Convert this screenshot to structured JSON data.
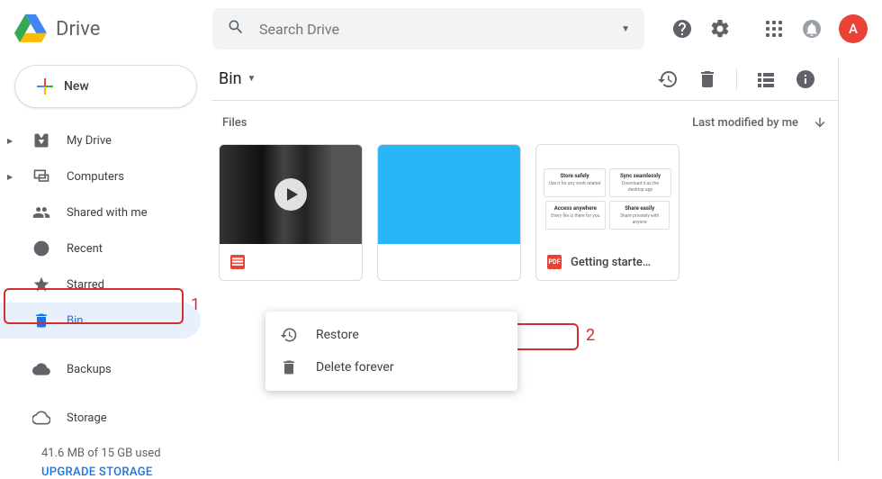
{
  "app_name": "Drive",
  "search_placeholder": "Search Drive",
  "avatar_letter": "A",
  "new_button": "New",
  "sidebar": {
    "items": [
      {
        "label": "My Drive",
        "icon": "drive"
      },
      {
        "label": "Computers",
        "icon": "computers"
      },
      {
        "label": "Shared with me",
        "icon": "shared"
      },
      {
        "label": "Recent",
        "icon": "recent"
      },
      {
        "label": "Starred",
        "icon": "star"
      },
      {
        "label": "Bin",
        "icon": "bin"
      },
      {
        "label": "Backups",
        "icon": "cloud-fill"
      },
      {
        "label": "Storage",
        "icon": "cloud"
      }
    ],
    "storage_text": "41.6 MB of 15 GB used",
    "upgrade_text": "UPGRADE STORAGE"
  },
  "location": "Bin",
  "files_heading": "Files",
  "sort_label": "Last modified by me",
  "files": [
    {
      "name": "",
      "type": "video"
    },
    {
      "name": "",
      "type": "image"
    },
    {
      "name": "Getting starte…",
      "type": "pdf"
    }
  ],
  "doc_preview": {
    "c1_title": "Store safely",
    "c2_title": "Sync seamlessly",
    "c3_title": "Access anywhere",
    "c4_title": "Share easily"
  },
  "context_menu": {
    "restore": "Restore",
    "delete": "Delete forever"
  },
  "callouts": {
    "one": "1",
    "two": "2"
  }
}
